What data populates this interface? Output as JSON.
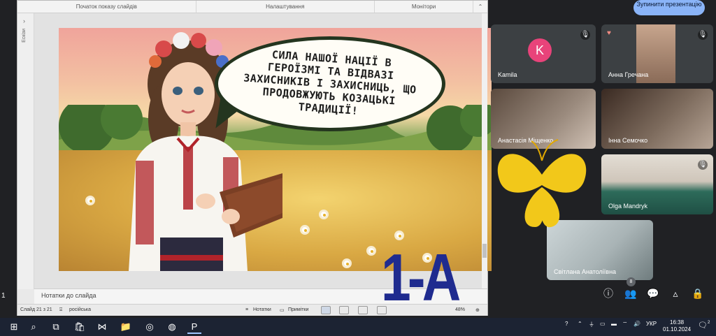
{
  "powerpoint": {
    "ribbon_groups": [
      "Початок показу слайдів",
      "Налаштування",
      "Монітори"
    ],
    "sidebar_label": "Ескізи",
    "slide_text": "СИЛА НАШОЇ НАЦІЇ В ГЕРОЇЗМІ ТА ВІДВАЗІ ЗАХИСНИКІВ І ЗАХИСНИЦЬ, ЩО ПРОДОВЖУЮТЬ КОЗАЦЬКІ ТРАДИЦІЇ!",
    "notes_placeholder": "Нотатки до слайда",
    "status": {
      "slide_counter": "Слайд 21 з 21",
      "language": "російська",
      "notes_btn": "Нотатки",
      "comments_btn": "Примітки",
      "zoom": "48%"
    }
  },
  "overlay_label": "1-А",
  "meet": {
    "stop_button": "Зупинити презентацію",
    "participants": [
      {
        "name": "Kamila",
        "initial": "K",
        "avatar_color": "#e8437a"
      },
      {
        "name": "Анна Гречана"
      },
      {
        "name": "Анастасія Міщенко"
      },
      {
        "name": "Інна Семочко"
      },
      {
        "name": "Olga Mandryk"
      },
      {
        "name": "Світлана Анатоліївна"
      }
    ],
    "people_count": "8"
  },
  "left_indicator": "1",
  "taskbar": {
    "lang": "УКР",
    "time": "16:38",
    "date": "01.10.2024",
    "notif_count": "2"
  },
  "colors": {
    "class_label": "#1f2b8f",
    "meet_bg": "#202124",
    "tile_bg": "#3c4043",
    "stop_button_bg": "#8ab4f8"
  }
}
